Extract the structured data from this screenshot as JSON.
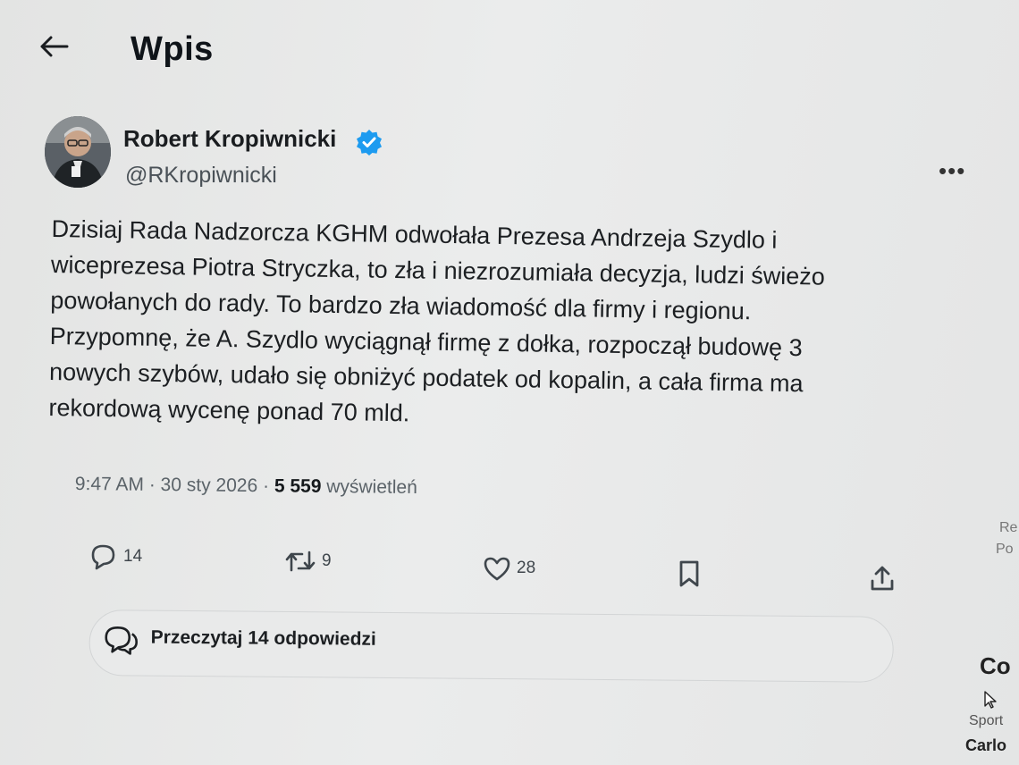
{
  "header": {
    "title": "Wpis",
    "back_icon": "arrow-left-icon"
  },
  "author": {
    "name": "Robert Kropiwnicki",
    "handle": "@RKropiwnicki",
    "verified": true,
    "verified_color": "#1d9bf0"
  },
  "tweet": {
    "lines": [
      "Dzisiaj Rada Nadzorcza KGHM odwołała Prezesa Andrzeja Szydlo i",
      "wiceprezesa Piotra Stryczka, to zła i niezrozumiała decyzja, ludzi świeżo",
      "powołanych do rady. To bardzo zła wiadomość dla firmy i regionu.",
      "Przypomnę, że A. Szydlo wyciągnął firmę z dołka, rozpoczął budowę 3",
      "nowych szybów, udało się obniżyć podatek od kopalin, a cała firma ma",
      "rekordową wycenę ponad 70 mld."
    ]
  },
  "meta": {
    "time": "9:47 AM",
    "date": "30 sty 2026",
    "views_count": "5 559",
    "views_label": "wyświetleń",
    "separator": "·"
  },
  "actions": {
    "reply_count": "14",
    "retweet_count": "9",
    "like_count": "28"
  },
  "read_replies": {
    "label": "Przeczytaj 14 odpowiedzi"
  },
  "sidebar_fragments": {
    "a": "Re",
    "b": "Po",
    "c": "Co",
    "d": "Sport",
    "e": "Carlo"
  }
}
